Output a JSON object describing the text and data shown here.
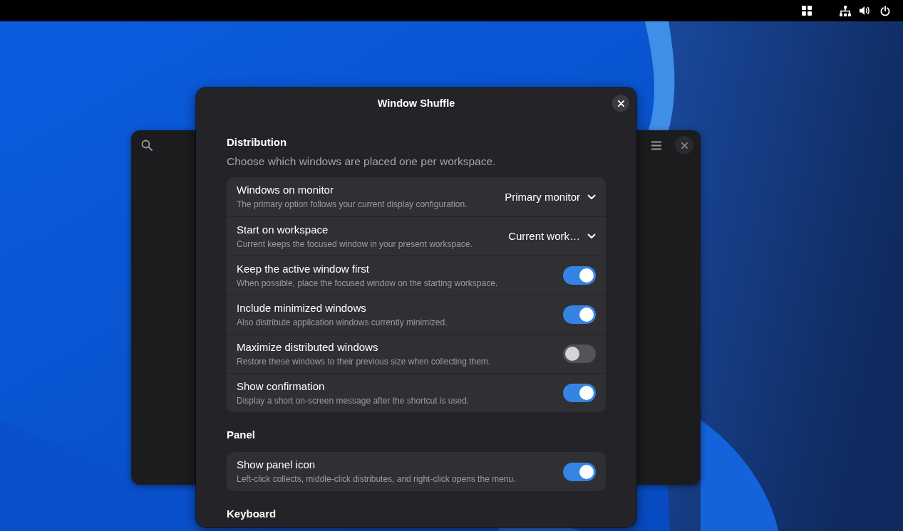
{
  "dialog": {
    "title": "Window Shuffle"
  },
  "sections": [
    {
      "title": "Distribution",
      "description": "Choose which windows are placed one per workspace.",
      "rows": [
        {
          "kind": "dropdown",
          "title": "Windows on monitor",
          "subtitle": "The primary option follows your current display configuration.",
          "value": "Primary monitor"
        },
        {
          "kind": "dropdown",
          "title": "Start on workspace",
          "subtitle": "Current keeps the focused window in your present workspace.",
          "value": "Current work…"
        },
        {
          "kind": "toggle",
          "title": "Keep the active window first",
          "subtitle": "When possible, place the focused window on the starting workspace.",
          "on": true
        },
        {
          "kind": "toggle",
          "title": "Include minimized windows",
          "subtitle": "Also distribute application windows currently minimized.",
          "on": true
        },
        {
          "kind": "toggle",
          "title": "Maximize distributed windows",
          "subtitle": "Restore these windows to their previous size when collecting them.",
          "on": false
        },
        {
          "kind": "toggle",
          "title": "Show confirmation",
          "subtitle": "Display a short on-screen message after the shortcut is used.",
          "on": true
        }
      ]
    },
    {
      "title": "Panel",
      "rows": [
        {
          "kind": "toggle",
          "title": "Show panel icon",
          "subtitle": "Left-click collects, middle-click distributes, and right-click opens the menu.",
          "on": true
        }
      ]
    },
    {
      "title": "Keyboard"
    }
  ]
}
